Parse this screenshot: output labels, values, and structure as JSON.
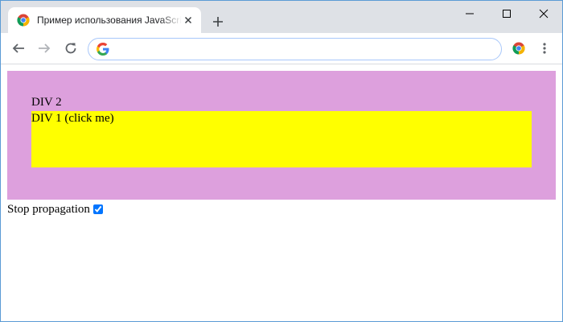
{
  "browser": {
    "tab_title": "Пример использования JavaScript",
    "address_value": "",
    "accent_color": "#1a73e8"
  },
  "icons": {
    "tab_favicon": "chrome-logo-icon",
    "tab_close": "close-icon",
    "new_tab": "plus-icon",
    "minimize": "minimize-icon",
    "maximize": "maximize-icon",
    "close": "close-icon",
    "back": "arrow-left-icon",
    "forward": "arrow-right-icon",
    "reload": "reload-icon",
    "omnibox": "google-g-icon",
    "extension": "chrome-logo-icon",
    "menu": "kebab-menu-icon"
  },
  "page": {
    "div2_label": "DIV 2",
    "div1_label": "DIV 1 (click me)",
    "div2_color": "#dda0dd",
    "div1_color": "#ffff00",
    "stop_propagation_label": "Stop propagation",
    "stop_propagation_checked": true
  }
}
